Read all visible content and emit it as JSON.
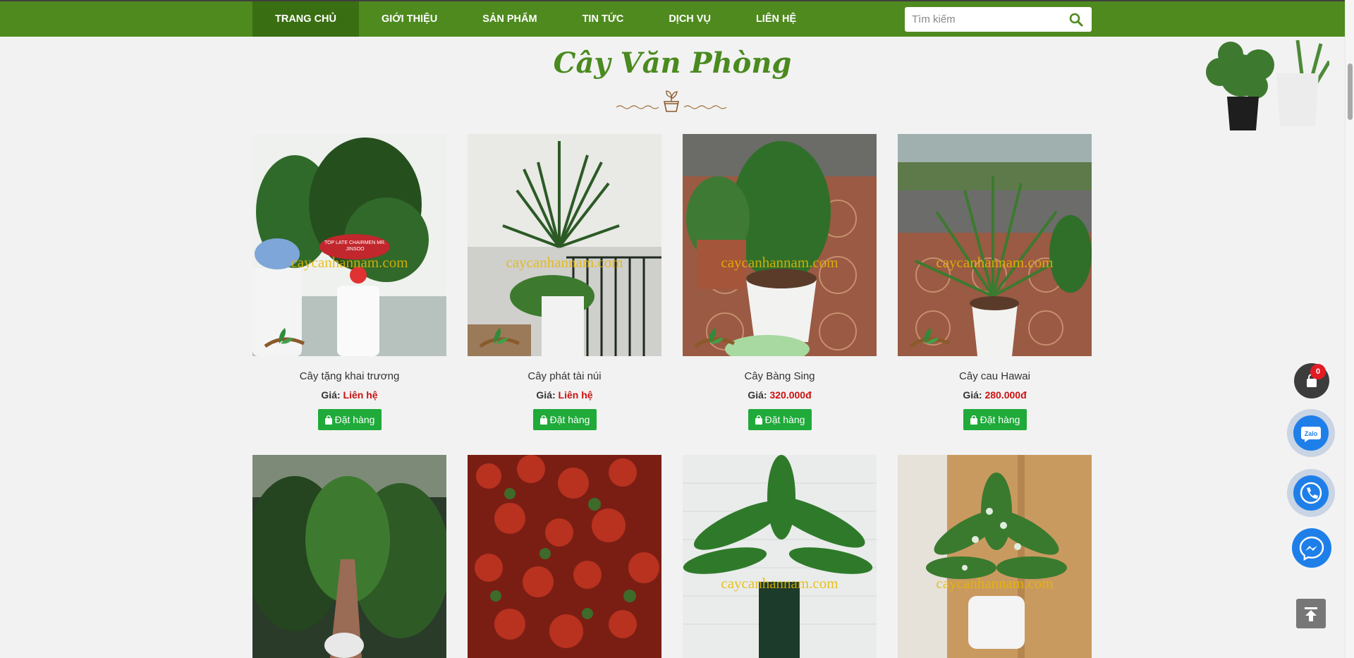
{
  "nav": {
    "items": [
      {
        "label": "TRANG CHỦ",
        "active": true
      },
      {
        "label": "GIỚI THIỆU",
        "active": false
      },
      {
        "label": "SẢN PHẨM",
        "active": false
      },
      {
        "label": "TIN TỨC",
        "active": false
      },
      {
        "label": "DỊCH VỤ",
        "active": false
      },
      {
        "label": "LIÊN HỆ",
        "active": false
      }
    ],
    "search_placeholder": "Tìm kiếm"
  },
  "section": {
    "title": "Cây Văn Phòng"
  },
  "products": [
    {
      "name": "Cây tặng khai trương",
      "price_label": "Giá:",
      "price": "Liên hệ",
      "button": "Đặt hàng",
      "watermark": "caycanhannam.com",
      "sign": "TOP LATE CHAIRMEN MR. JINSOO"
    },
    {
      "name": "Cây phát tài núi",
      "price_label": "Giá:",
      "price": "Liên hệ",
      "button": "Đặt hàng",
      "watermark": "caycanhannam.com"
    },
    {
      "name": "Cây Bàng Sing",
      "price_label": "Giá:",
      "price": "320.000đ",
      "button": "Đặt hàng",
      "watermark": "caycanhannam.com"
    },
    {
      "name": "Cây cau Hawai",
      "price_label": "Giá:",
      "price": "280.000đ",
      "button": "Đặt hàng",
      "watermark": "caycanhannam.com"
    },
    {
      "watermark": ""
    },
    {
      "watermark": ""
    },
    {
      "watermark": "caycanhannam.com"
    },
    {
      "watermark": "caycanhannam.com"
    }
  ],
  "cart": {
    "count": "0"
  },
  "colors": {
    "nav_bg": "#4f8a1f",
    "nav_active": "#3a6e12",
    "title_green": "#4a8a1f",
    "price_red": "#cc1111",
    "order_button": "#1faa3a",
    "fab_blue": "#1f7fe9"
  },
  "icons": {
    "search": "search-icon",
    "cart": "shopping-bag-icon",
    "zalo": "zalo-icon",
    "phone": "phone-icon",
    "messenger": "messenger-icon",
    "to_top": "arrow-up-icon"
  }
}
